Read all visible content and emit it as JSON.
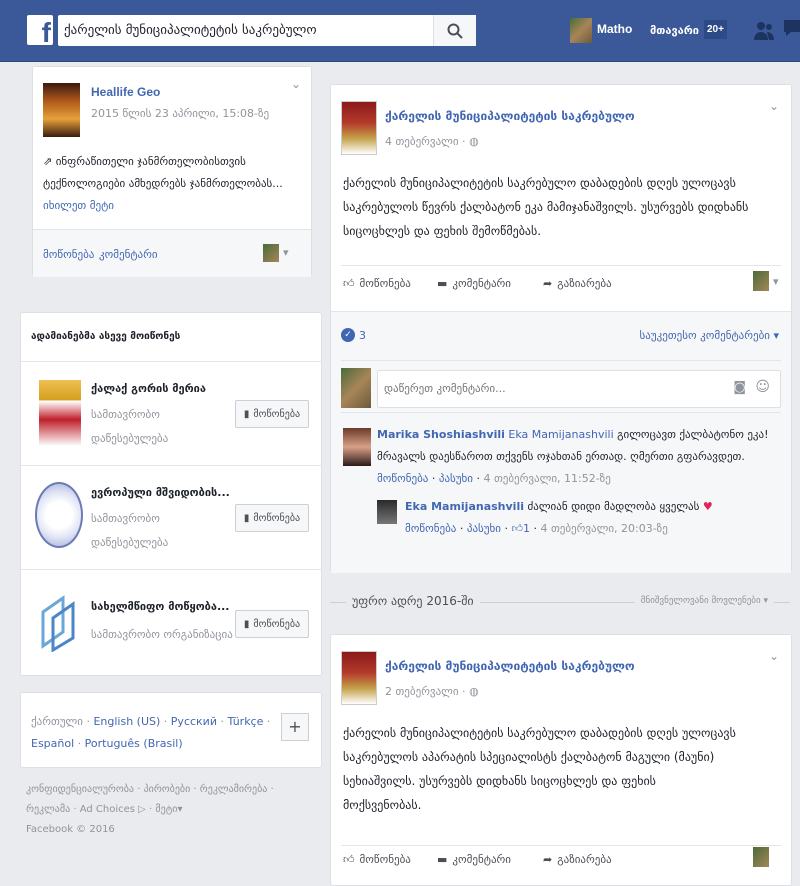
{
  "topbar": {
    "logo": "f",
    "search_value": "ქარელის მუნიციპალიტეტის საკრებულო",
    "user_name": "Matho",
    "home_label": "მთავარი",
    "notif_count": "20+"
  },
  "ad_card": {
    "page_name": "Heallife Geo",
    "date": "2015 წლის 23 აპრილი, 15:08-ზე",
    "text_line1": "ინფრაწითელი ჯანმრთელობისთვის",
    "text_line2": "ტექნოლოგიები ამხედრებს ჯანმრთელობას...",
    "see_more": "იხილეთ მეტი",
    "like": "მოწონება",
    "comment": "კომენტარი"
  },
  "suggested": {
    "title": "ადამიანებმა ასევე მოიწონეს",
    "like_label": "მოწონება",
    "items": [
      {
        "name": "ქალაქ გორის მერია",
        "cat1": "სამთავრობო",
        "cat2": "დაწესებულება"
      },
      {
        "name": "ევროპული მშვიდობის...",
        "cat1": "სამთავრობო",
        "cat2": "დაწესებულება"
      },
      {
        "name": "სახელმწიფო მოწყობა...",
        "cat1": "სამთავრობო ორგანიზაცია",
        "cat2": ""
      }
    ]
  },
  "languages": {
    "current": "ქართული",
    "links": [
      "English (US)",
      "Русский",
      "Türkçe",
      "Español",
      "Português (Brasil)"
    ],
    "add": "+"
  },
  "footer": {
    "line1": [
      "კონფიდენციალურობა",
      "პირობები",
      "რეკლამირება"
    ],
    "line2": [
      "რეკლამა",
      "Ad Choices",
      "მეტი"
    ],
    "copyright": "Facebook © 2016"
  },
  "post1": {
    "page_name": "ქარელის მუნიციპალიტეტის საკრებულო",
    "date": "4 თებერვალი",
    "text": [
      "ქარელის მუნიციპალიტეტის საკრებულო დაბადების დღეს ულოცავს",
      "საკრებულოს წევრს ქალბატონ ეკა მამიჯანაშვილს. უსურვებს დიდხანს",
      "სიცოცხლეს და ფეხის შემოწმებას."
    ],
    "like": "მოწონება",
    "comment": "კომენტარი",
    "share": "გაზიარება",
    "reactions_count": "3",
    "top_comments": "საუკეთესო კომენტარები",
    "comment_placeholder": "დაწერეთ კომენტარი...",
    "comments": [
      {
        "author": "Marika Shoshiashvili",
        "mention": "Eka Mamijanashvili",
        "text1": "გილოცავთ ქალბატონო ეკა!",
        "text2": "მრავალს დაესწაროთ თქვენს ოჯახთან ერთად. ღმერთი გფარავდეთ.",
        "like": "მოწონება",
        "reply": "პასუხი",
        "date": "4 თებერვალი, 11:52-ზე"
      }
    ],
    "reply": {
      "author": "Eka Mamijanashvili",
      "text": "ძალიან დიდი მადლობა ყველას",
      "like": "მოწონება",
      "reply": "პასუხი",
      "likes": "1",
      "date": "4 თებერვალი, 20:03-ზე"
    }
  },
  "separator": {
    "label": "უფრო ადრე 2016-ში",
    "right": "მნიშვნელოვანი მოვლენები"
  },
  "post2": {
    "page_name": "ქარელის მუნიციპალიტეტის საკრებულო",
    "date": "2 თებერვალი",
    "text": [
      "ქარელის მუნიციპალიტეტის საკრებულო დაბადების დღეს ულოცავს",
      "საკრებულოს აპარატის სპეციალისტს ქალბატონ მაგული (მაუნი)",
      "სეხიაშვილს. უსურვებს დიდხანს სიცოცხლეს და ფეხის",
      "მოქსვენობას."
    ],
    "like": "მოწონება",
    "comment": "კომენტარი",
    "share": "გაზიარება"
  }
}
